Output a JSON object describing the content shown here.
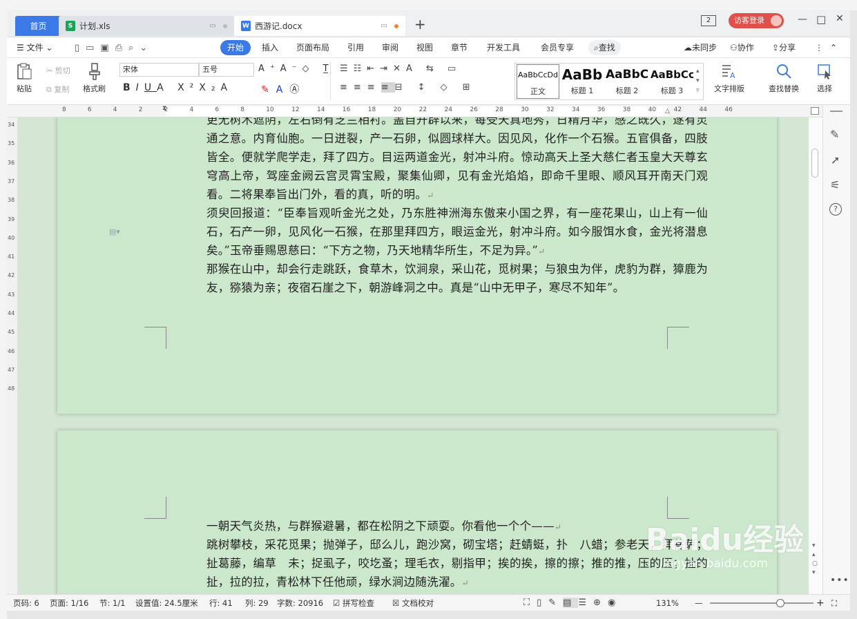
{
  "tabs": {
    "home": "首页",
    "file1": "计划.xls",
    "file2": "西游记.docx",
    "new_tab": "+"
  },
  "window": {
    "badge": "2",
    "login": "访客登录",
    "min": "—",
    "max": "□",
    "close": "✕"
  },
  "menu": {
    "file": "文件",
    "start": "开始",
    "insert": "插入",
    "layout": "页面布局",
    "ref": "引用",
    "review": "审阅",
    "view": "视图",
    "section": "章节",
    "dev": "开发工具",
    "vip": "会员专享",
    "search": "查找",
    "sync": "未同步",
    "collab": "协作",
    "share": "分享"
  },
  "ribbon": {
    "paste": "粘贴",
    "cut": "剪切",
    "copy": "复制",
    "format_painter": "格式刷",
    "font": "宋体",
    "size": "五号",
    "styles": [
      {
        "preview": "AaBbCcDd",
        "name": "正文"
      },
      {
        "preview": "AaBb",
        "name": "标题 1"
      },
      {
        "preview": "AaBbC",
        "name": "标题 2"
      },
      {
        "preview": "AaBbCc",
        "name": "标题 3"
      }
    ],
    "text_layout": "文字排版",
    "find_replace": "查找替换",
    "select": "选择"
  },
  "ruler": {
    "ticks": [
      "8",
      "6",
      "4",
      "2",
      "2",
      "4",
      "6",
      "8",
      "10",
      "12",
      "14",
      "16",
      "18",
      "20",
      "22",
      "24",
      "26",
      "28",
      "30",
      "32",
      "34",
      "36",
      "38",
      "40",
      "42",
      "44",
      "46"
    ]
  },
  "vruler": {
    "ticks": [
      "34",
      "35",
      "36",
      "37",
      "38",
      "39",
      "40",
      "41",
      "42",
      "43",
      "44",
      "45",
      "46",
      "47",
      "48"
    ]
  },
  "document": {
    "page1": [
      "更无树木遮阴，左右倒有芝兰相衬。盖自开辟以来，每受天真地秀，日精月华，感之既久，遂有灵通之意。内育仙胞。一日迸裂，产一石卵，似圆球样大。因见风，化作一个石猴。五官俱备，四肢皆全。便就学爬学走，拜了四方。目运两道金光，射冲斗府。惊动高天上圣大慈仁者玉皇大天尊玄穹高上帝，驾座金阙云宫灵霄宝殿，聚集仙卿，见有金光焰焰，即命千里眼、顺风耳开南天门观看。二将果奉旨出门外，看的真，听的明。",
      "须臾回报道：“臣奉旨观听金光之处，乃东胜神洲海东傲来小国之界，有一座花果山，山上有一仙石，石产一卵，见风化一石猴，在那里拜四方，眼运金光，射冲斗府。如今服饵水食，金光将潜息矣。”玉帝垂赐恩慈曰：“下方之物，乃天地精华所生，不足为异。”",
      "那猴在山中，却会行走跳跃，食草木，饮涧泉，采山花，觅树果；与狼虫为伴，虎豹为群，獐鹿为友，猕猿为亲；夜宿石崖之下，朝游峰洞之中。真是“山中无甲子，寒尽不知年”。"
    ],
    "page2": [
      "一朝天气炎热，与群猴避暑，都在松阴之下顽耍。你看他一个个——",
      "跳树攀枝，采花觅果；抛弹子，邸么儿，跑沙窝，砌宝塔；赶蜻蜓，扑　八蜡；参老天，拜菩萨；扯葛藤，编草　未；捉虱子，咬圪蚤；理毛衣，剔指甲；挨的挨，擦的擦；推的推，压的压；扯的扯，拉的拉，青松林下任他顽，绿水涧边随洗濯。"
    ],
    "return_mark": "↵"
  },
  "status": {
    "page_num": "页码: 6",
    "page": "页面: 1/16",
    "section": "节: 1/1",
    "setting": "设置值: 24.5厘米",
    "row": "行: 41",
    "col": "列: 29",
    "words": "字数: 20916",
    "spell": "拼写检查",
    "proof": "文档校对",
    "zoom": "131%",
    "minus": "—",
    "plus": "+"
  },
  "watermark": {
    "main": "Baidu经验",
    "sub": "jingyan.baidu.com"
  },
  "colors": {
    "accent": "#3a79e6",
    "page_bg": "#cce8cc",
    "login_bg": "#e0504a"
  }
}
